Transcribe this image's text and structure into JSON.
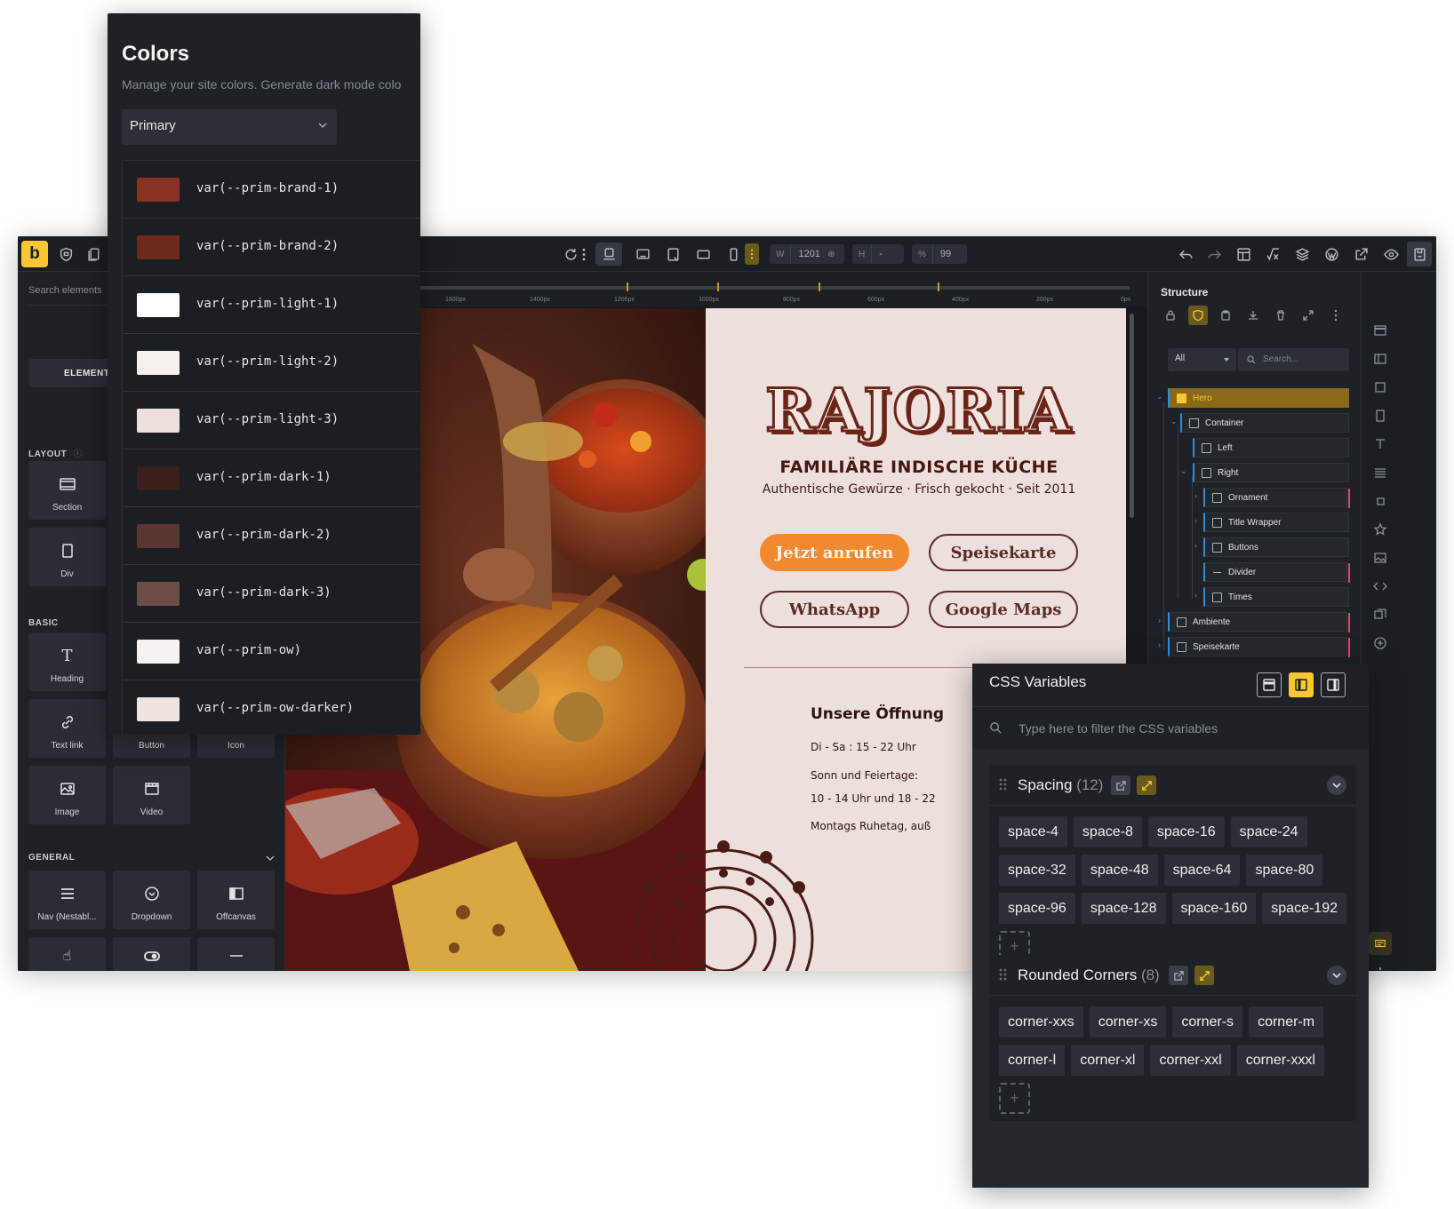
{
  "toolbar": {
    "logo": "b",
    "width_label": "W",
    "width_value": "1201",
    "height_label": "H",
    "height_value": "-",
    "percent_label": "%",
    "percent_value": "99"
  },
  "left_panel": {
    "search_placeholder": "Search elements",
    "tab_elements": "ELEMENT",
    "layout_label": "LAYOUT",
    "basic_label": "BASIC",
    "general_label": "GENERAL",
    "layout_items": [
      {
        "label": "Section",
        "icon": "section-icon"
      },
      {
        "label": "Div",
        "icon": "div-icon"
      }
    ],
    "basic_items": [
      {
        "label": "Heading",
        "icon": "heading-icon"
      },
      {
        "label": "Text link",
        "icon": "link-icon"
      },
      {
        "label": "Button",
        "icon": "button-icon"
      },
      {
        "label": "Icon",
        "icon": "star-icon"
      },
      {
        "label": "Image",
        "icon": "image-icon"
      },
      {
        "label": "Video",
        "icon": "video-icon"
      }
    ],
    "general_items": [
      {
        "label": "Nav (Nestabl...",
        "icon": "menu-icon"
      },
      {
        "label": "Dropdown",
        "icon": "dropdown-icon"
      },
      {
        "label": "Offcanvas",
        "icon": "offcanvas-icon"
      }
    ]
  },
  "canvas": {
    "ruler_ticks": [
      "1600px",
      "1400px",
      "1200px",
      "1000px",
      "800px",
      "600px",
      "400px",
      "200px",
      "0px"
    ],
    "hero": {
      "title": "RAJORIA",
      "subtitle": "FAMILIÄRE INDISCHE KÜCHE",
      "tagline": "Authentische Gewürze · Frisch gekocht · Seit 2011",
      "btn_call": "Jetzt anrufen",
      "btn_menu": "Speisekarte",
      "btn_whatsapp": "WhatsApp",
      "btn_maps": "Google Maps",
      "hours_title": "Unsere Öffnung",
      "hours_1": "Di - Sa : 15 - 22 Uhr",
      "hours_2": "Sonn und Feiertage:",
      "hours_3": "10 - 14 Uhr und 18 - 22",
      "hours_4": "Montags Ruhetag, auß"
    }
  },
  "structure": {
    "title": "Structure",
    "filter": "All",
    "search_placeholder": "Search...",
    "tree": [
      "Hero",
      "Container",
      "Left",
      "Right",
      "Ornament",
      "Title Wrapper",
      "Buttons",
      "Divider",
      "Times",
      "Ambiente",
      "Speisekarte"
    ]
  },
  "colors_panel": {
    "title": "Colors",
    "description": "Manage your site colors. Generate dark mode colo",
    "palette": "Primary",
    "colors": [
      {
        "name": "var(--prim-brand-1)",
        "hex": "#8a3221"
      },
      {
        "name": "var(--prim-brand-2)",
        "hex": "#6e2a1c"
      },
      {
        "name": "var(--prim-light-1)",
        "hex": "#ffffff"
      },
      {
        "name": "var(--prim-light-2)",
        "hex": "#f7f1ee"
      },
      {
        "name": "var(--prim-light-3)",
        "hex": "#ecdfdc"
      },
      {
        "name": "var(--prim-dark-1)",
        "hex": "#3a1f1b"
      },
      {
        "name": "var(--prim-dark-2)",
        "hex": "#5a3631"
      },
      {
        "name": "var(--prim-dark-3)",
        "hex": "#6f4d47"
      },
      {
        "name": "var(--prim-ow)",
        "hex": "#f7f2ef"
      },
      {
        "name": "var(--prim-ow-darker)",
        "hex": "#efe5e0"
      }
    ]
  },
  "css_variables": {
    "title": "CSS Variables",
    "search_placeholder": "Type here to filter the CSS variables",
    "groups": [
      {
        "name": "Spacing",
        "count": "(12)",
        "items": [
          "space-4",
          "space-8",
          "space-16",
          "space-24",
          "space-32",
          "space-48",
          "space-64",
          "space-80",
          "space-96",
          "space-128",
          "space-160",
          "space-192"
        ]
      },
      {
        "name": "Rounded Corners",
        "count": "(8)",
        "items": [
          "corner-xxs",
          "corner-xs",
          "corner-s",
          "corner-m",
          "corner-l",
          "corner-xl",
          "corner-xxl",
          "corner-xxxl"
        ]
      }
    ]
  },
  "accent_color": "#f9c634"
}
